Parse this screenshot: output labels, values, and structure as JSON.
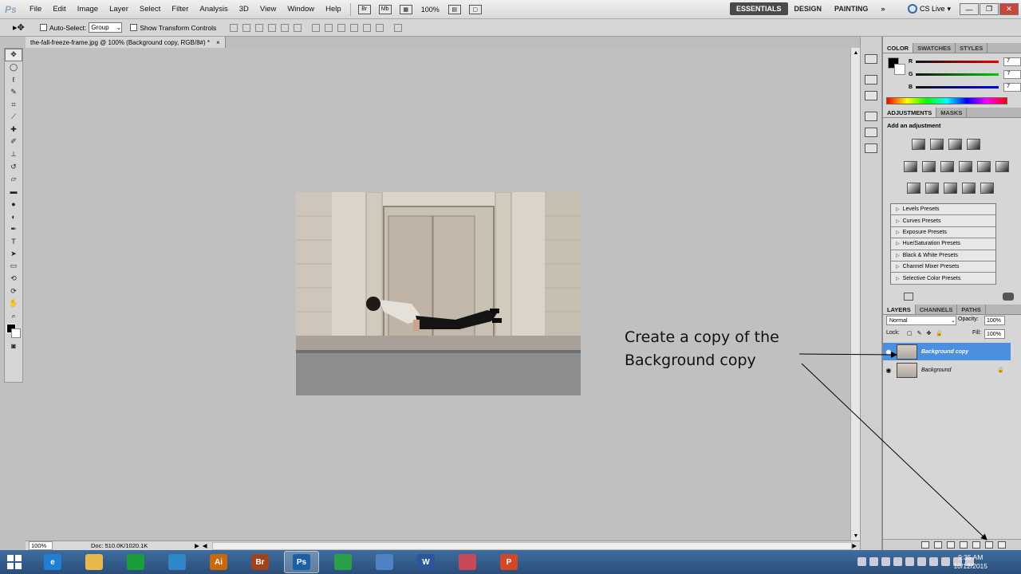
{
  "menubar": {
    "logo": "Ps",
    "items": [
      "File",
      "Edit",
      "Image",
      "Layer",
      "Select",
      "Filter",
      "Analysis",
      "3D",
      "View",
      "Window",
      "Help"
    ],
    "zoom": "100%",
    "workspaces": [
      "ESSENTIALS",
      "DESIGN",
      "PAINTING"
    ],
    "overflow": "»",
    "cs_live": "CS Live"
  },
  "optionsbar": {
    "auto_select_label": "Auto-Select:",
    "auto_select_value": "Group",
    "show_transform_label": "Show Transform Controls"
  },
  "document": {
    "tab_title": "the-fall-freeze-frame.jpg @ 100% (Background copy, RGB/8#) *",
    "close": "×"
  },
  "statusbar": {
    "zoom": "100%",
    "doc_info": "Doc: 510.0K/1020.1K"
  },
  "color_panel": {
    "tabs": [
      "COLOR",
      "SWATCHES",
      "STYLES"
    ],
    "r_label": "R",
    "g_label": "G",
    "b_label": "B",
    "r_value": "7",
    "g_value": "7",
    "b_value": "7"
  },
  "adjustments_panel": {
    "tabs": [
      "ADJUSTMENTS",
      "MASKS"
    ],
    "title": "Add an adjustment",
    "presets": [
      "Levels Presets",
      "Curves Presets",
      "Exposure Presets",
      "Hue/Saturation Presets",
      "Black & White Presets",
      "Channel Mixer Presets",
      "Selective Color Presets"
    ]
  },
  "layers_panel": {
    "tabs": [
      "LAYERS",
      "CHANNELS",
      "PATHS"
    ],
    "blend_mode": "Normal",
    "opacity_label": "Opacity:",
    "opacity_value": "100%",
    "lock_label": "Lock:",
    "fill_label": "Fill:",
    "fill_value": "100%",
    "layers": [
      {
        "name": "Background copy",
        "selected": true
      },
      {
        "name": "Background",
        "selected": false
      }
    ]
  },
  "annotation": {
    "text_line1": "Create a copy of the",
    "text_line2": "Background copy"
  },
  "taskbar": {
    "time": "9:35 AM",
    "date": "10/12/2015",
    "apps": [
      {
        "icon": "internet-explorer-icon",
        "label": "e",
        "color": "#1e7fd3"
      },
      {
        "icon": "file-explorer-icon",
        "label": "",
        "color": "#e8b84a"
      },
      {
        "icon": "store-icon",
        "label": "",
        "color": "#1b9e3a"
      },
      {
        "icon": "settings-icon",
        "label": "",
        "color": "#2f86c9"
      },
      {
        "icon": "illustrator-icon",
        "label": "Ai",
        "color": "#c8690e"
      },
      {
        "icon": "bridge-icon",
        "label": "Br",
        "color": "#a2421b"
      },
      {
        "icon": "photoshop-icon",
        "label": "Ps",
        "color": "#1b5fa6"
      },
      {
        "icon": "chrome-icon",
        "label": "",
        "color": "#2aa146"
      },
      {
        "icon": "remote-desktop-icon",
        "label": "",
        "color": "#4f83c4"
      },
      {
        "icon": "word-icon",
        "label": "W",
        "color": "#2b579a"
      },
      {
        "icon": "snipping-tool-icon",
        "label": "",
        "color": "#c9485a"
      },
      {
        "icon": "powerpoint-icon",
        "label": "P",
        "color": "#d24726"
      }
    ]
  }
}
